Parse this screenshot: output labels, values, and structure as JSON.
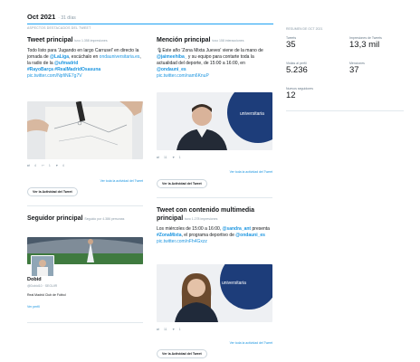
{
  "header": {
    "month": "Oct 2021",
    "days": "· 31 días",
    "subheader": "ASPECTOS DESTACADOS DEL TWEET"
  },
  "top_tweet": {
    "title": "Tweet principal",
    "meta": "tuvo 1.358 impresiones",
    "text_1": "Todo listo para 'Jugando en largo Carrusel' en directo la jornada de ",
    "handle_1": "@LaLiga",
    "text_2": ", escúchalo en ",
    "link_1": "ondauniversitaria.es",
    "text_3": ", la radio de la ",
    "handle_2": "@ufmadrid",
    "hashtags": "#RayoBarça #RealMadridOsasuna",
    "pic": "pic.twitter.com/NpfiNE7g7V",
    "stats": {
      "retweets": "4",
      "replies": "1",
      "likes": "4",
      "impressions": ""
    },
    "see_all": "Ver toda la actividad del Tweet",
    "button": "Ver la Actividad del Tweet"
  },
  "top_mention": {
    "title": "Mención principal",
    "meta": "tuvo 158 interacciones",
    "text_1": "🎙Este año 'Zona Mixta Jueves' viene de la mano de ",
    "handle_1": "@jaimeehiba_",
    "text_2": " y su equipo para contarte toda la actualidad del deporte, de 15:00 a 16:00, en ",
    "handle_2": "@ondauni_es",
    "pic": "pic.twitter.com/nam6KnuP",
    "stats": {
      "retweets": "11",
      "replies": "",
      "likes": "1"
    },
    "see_all": "Ver toda la actividad del Tweet",
    "button": "Ver la Actividad del Tweet"
  },
  "top_follower": {
    "title": "Seguidor principal",
    "meta": "Seguido por 4.386 personas",
    "name": "Dobid",
    "handle": "@Dobid10 · SEGUIR",
    "bio": "Real Madrid Club de Fútbol",
    "link": "Ver perfil"
  },
  "top_media_tweet": {
    "title": "Tweet con contenido multimedia principal",
    "meta": "tuvo 1.278 impresiones",
    "text_1": "Los miércoles de 15:00 a 16:00, ",
    "handle_1": "@sandra_ant",
    "text_2": " presenta ",
    "hashtag": "#ZonaMixta",
    "text_3": ", el programa deportivo de ",
    "handle_2": "@ondauni_es",
    "pic": "pic.twitter.com/nFh4Gxzz",
    "stats": {
      "retweets": "11",
      "replies": "",
      "likes": "1"
    },
    "see_all": "Ver toda la actividad del Tweet",
    "button": "Ver la Actividad del Tweet"
  },
  "summary": {
    "title": "RESUMEN DE OCT 2021",
    "metrics": [
      {
        "label": "Tweets",
        "value": "35"
      },
      {
        "label": "Impresiones de Tweets",
        "value": "13,3 mil"
      },
      {
        "label": "Visitas al perfil",
        "value": "5.236"
      },
      {
        "label": "Menciones",
        "value": "37"
      },
      {
        "label": "Nuevos seguidores",
        "value": "12"
      }
    ]
  },
  "colors": {
    "accent": "#1da1f2",
    "link": "#1b95e0",
    "muted": "#8899a6"
  }
}
